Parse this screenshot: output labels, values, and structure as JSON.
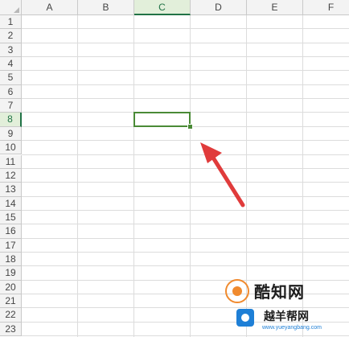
{
  "columns": [
    "A",
    "B",
    "C",
    "D",
    "E",
    "F"
  ],
  "rows": [
    "1",
    "2",
    "3",
    "4",
    "5",
    "6",
    "7",
    "8",
    "9",
    "10",
    "11",
    "12",
    "13",
    "14",
    "15",
    "16",
    "17",
    "18",
    "19",
    "20",
    "21",
    "22",
    "23"
  ],
  "selected": {
    "column": "C",
    "row": "8"
  },
  "colors": {
    "selection": "#4a8a36",
    "arrow": "#e03b3b",
    "header_active_bg": "#e2efda"
  },
  "watermark": {
    "line1": "酷知网",
    "line2": "越羊帮网",
    "line3": "www.yueyangbang.com",
    "icon": "brand-logo-icon"
  },
  "annotation": {
    "icon": "arrow-icon"
  }
}
